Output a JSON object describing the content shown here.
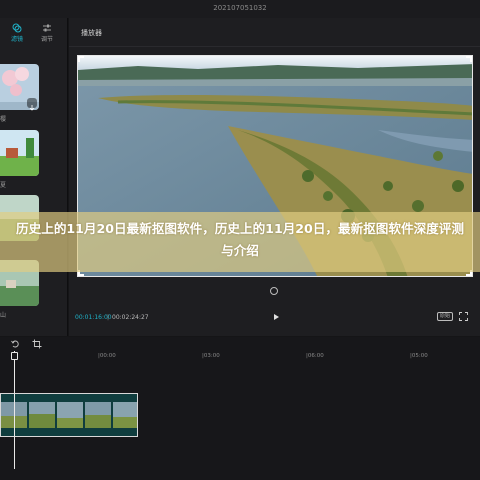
{
  "window": {
    "project_name": "202107051032"
  },
  "left_panel": {
    "tabs": [
      {
        "label": "滤镜",
        "icon": "filter-icon",
        "active": true
      },
      {
        "label": "调节",
        "icon": "adjust-icon",
        "active": false
      }
    ],
    "items": [
      {
        "label": "樱"
      },
      {
        "label": "夏"
      },
      {
        "label": ""
      },
      {
        "label": "山"
      }
    ]
  },
  "player": {
    "title": "播放器",
    "time_current": "00:01:16:00",
    "time_total": "00:02:24:27",
    "ratio_label": "原始",
    "accent_color": "#20b3c9"
  },
  "timeline": {
    "ruler_labels": [
      "|00:00",
      "|03:00",
      "|06:00",
      "|05:00"
    ]
  },
  "overlay": {
    "headline": "历史上的11月20日最新抠图软件，历史上的11月20日，最新抠图软件深度评测与介绍"
  }
}
